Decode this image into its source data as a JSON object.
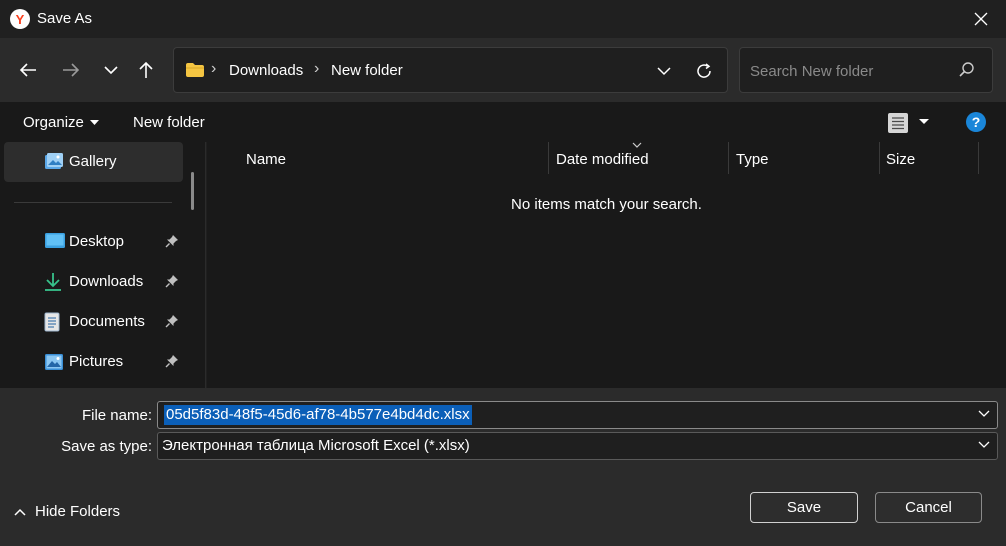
{
  "window": {
    "title": "Save As",
    "app_logo_letter": "Y",
    "close_icon": "close-icon"
  },
  "nav": {
    "back_icon": "arrow-left-icon",
    "forward_icon": "arrow-right-icon",
    "recent_icon": "chevron-down-icon",
    "up_icon": "arrow-up-icon"
  },
  "address": {
    "crumbs": [
      "Downloads",
      "New folder"
    ],
    "separator": "›",
    "dropdown_icon": "chevron-down-icon",
    "refresh_icon": "refresh-icon"
  },
  "search": {
    "placeholder": "Search New folder",
    "value": ""
  },
  "toolbar": {
    "organize_label": "Organize",
    "new_folder_label": "New folder",
    "view_icon": "details-view-icon",
    "help_label": "?"
  },
  "sidebar": {
    "items": [
      {
        "label": "Gallery",
        "icon": "gallery-icon",
        "pinned": false,
        "selected": true
      },
      {
        "label": "Desktop",
        "icon": "desktop-icon",
        "pinned": true
      },
      {
        "label": "Downloads",
        "icon": "download-icon",
        "pinned": true
      },
      {
        "label": "Documents",
        "icon": "document-icon",
        "pinned": true
      },
      {
        "label": "Pictures",
        "icon": "pictures-icon",
        "pinned": true
      }
    ]
  },
  "file_list": {
    "columns": [
      "Name",
      "Date modified",
      "Type",
      "Size"
    ],
    "sorted_column": "Date modified",
    "empty_message": "No items match your search."
  },
  "form": {
    "file_name_label": "File name:",
    "file_name_value": "05d5f83d-48f5-45d6-af78-4b577e4bd4dc.xlsx",
    "save_type_label": "Save as type:",
    "save_type_value": "Электронная таблица Microsoft Excel (*.xlsx)"
  },
  "footer": {
    "hide_folders_label": "Hide Folders",
    "save_label": "Save",
    "cancel_label": "Cancel"
  },
  "colors": {
    "background": "#202020",
    "accent": "#0b5fb8",
    "help": "#1a86d9",
    "folder": "#f4c542"
  }
}
